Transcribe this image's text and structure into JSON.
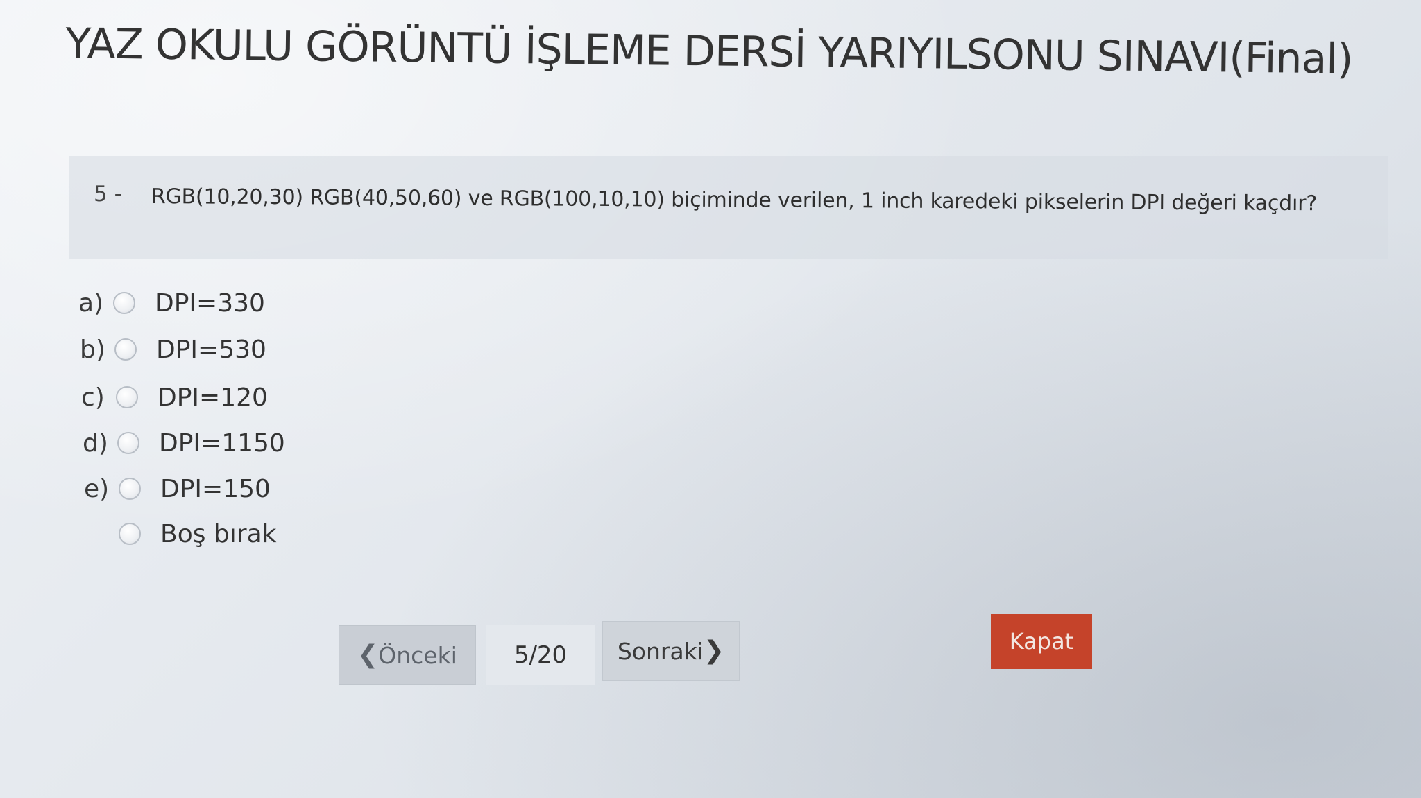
{
  "header": {
    "title": "YAZ OKULU GÖRÜNTÜ İŞLEME DERSİ YARIYILSONU SINAVI(Final)"
  },
  "question": {
    "number": "5 -",
    "text": "RGB(10,20,30) RGB(40,50,60) ve RGB(100,10,10) biçiminde verilen, 1 inch karedeki pikselerin DPI değeri kaçdır?",
    "options": [
      {
        "letter": "a)",
        "label": "DPI=330"
      },
      {
        "letter": "b)",
        "label": "DPI=530"
      },
      {
        "letter": "c)",
        "label": "DPI=120"
      },
      {
        "letter": "d)",
        "label": "DPI=1150"
      },
      {
        "letter": "e)",
        "label": "DPI=150"
      },
      {
        "letter": "",
        "label": "Boş bırak"
      }
    ]
  },
  "navigation": {
    "prev_label": "Önceki",
    "prev_icon": "chevron-left-icon",
    "page_indicator": "5/20",
    "next_label": "Sonraki",
    "next_icon": "chevron-right-icon",
    "close_label": "Kapat"
  },
  "colors": {
    "close_button": "#c5432a",
    "page_background": "#e6eaef"
  }
}
